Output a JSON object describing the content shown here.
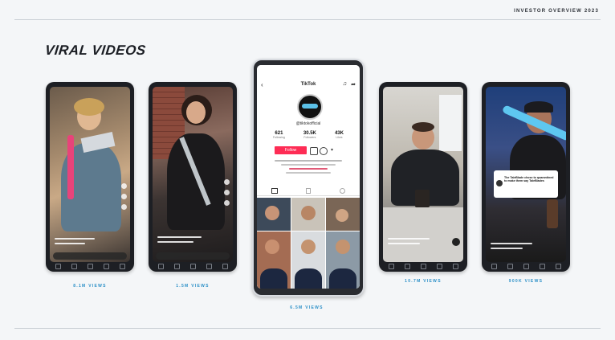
{
  "header": {
    "label": "INVESTOR OVERVIEW 2023"
  },
  "title": "VIRAL VIDEOS",
  "captions": [
    "8.1M VIEWS",
    "1.5M VIEWS",
    "6.5M VIEWS",
    "10.7M VIEWS",
    "900K VIEWS"
  ],
  "profile": {
    "app_name": "TikTok",
    "handle": "@tiktokofficial",
    "stats": [
      {
        "value": "621",
        "label": "Following"
      },
      {
        "value": "30.5K",
        "label": "Followers"
      },
      {
        "value": "43K",
        "label": "Likes"
      }
    ],
    "follow_label": "Follow"
  },
  "overlay_post": {
    "caption": "The TaleBlade chose to quarantined to make them say TaleBlades"
  },
  "colors": {
    "accent": "#2a8fc7",
    "follow": "#fe2c55"
  }
}
